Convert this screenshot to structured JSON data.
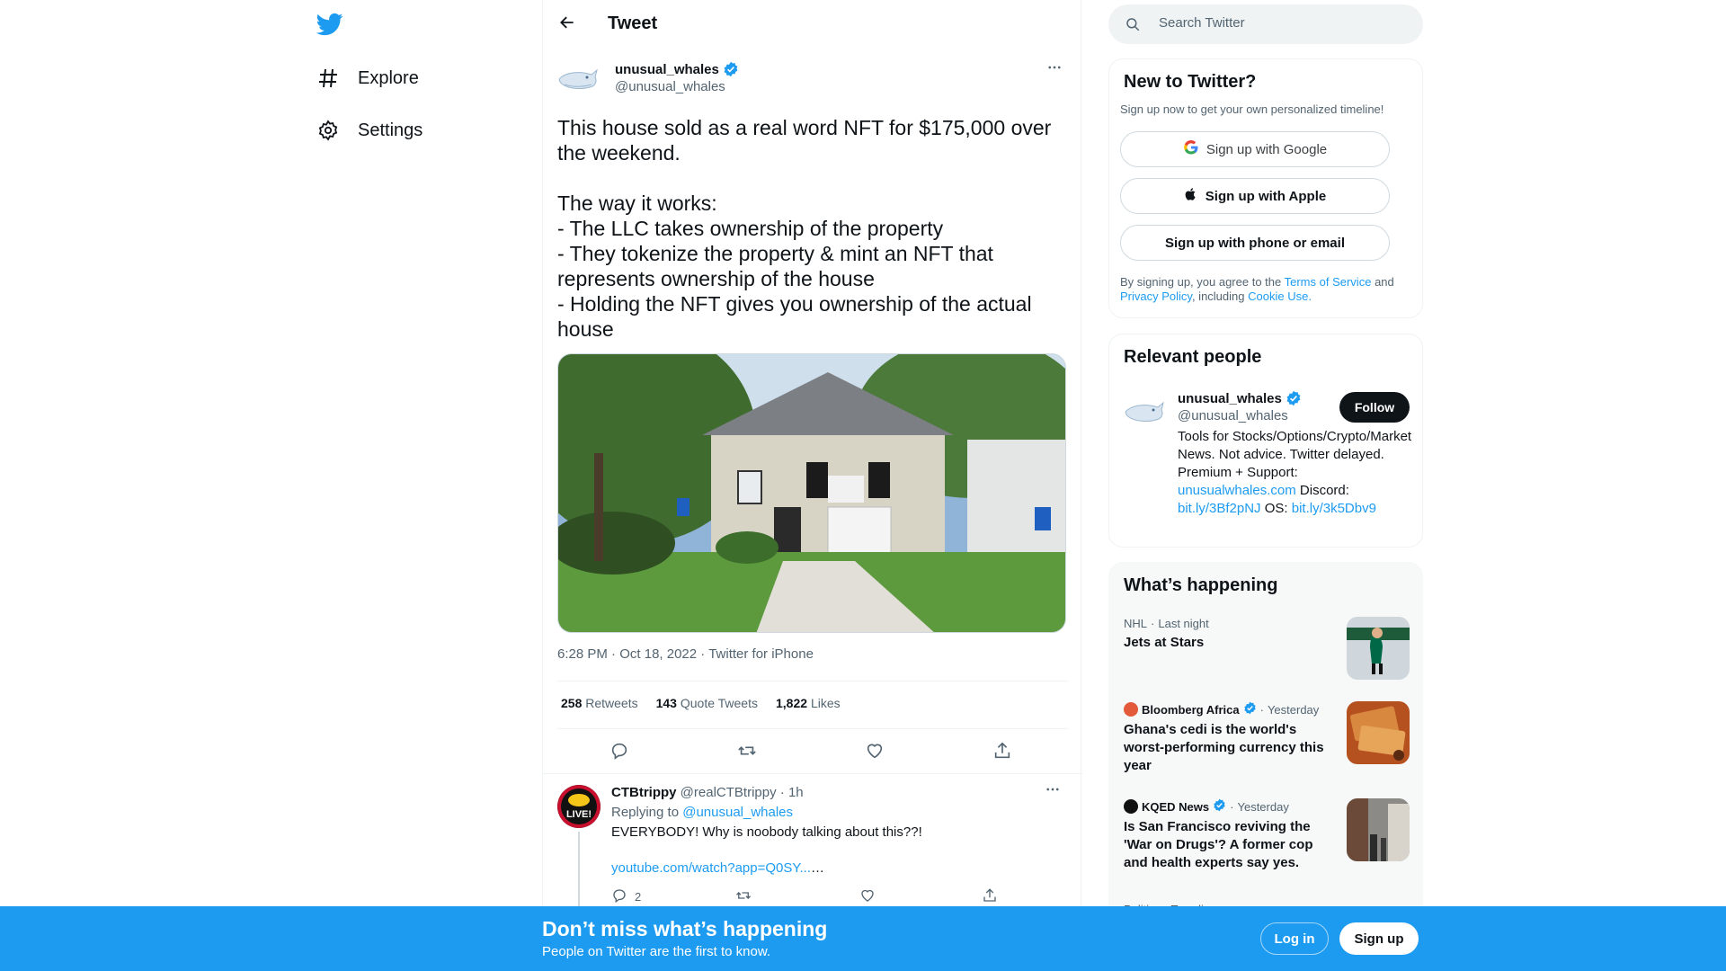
{
  "nav": {
    "items": [
      {
        "label": "Explore",
        "icon": "hashtag-icon"
      },
      {
        "label": "Settings",
        "icon": "gear-icon"
      }
    ]
  },
  "header": {
    "title": "Tweet"
  },
  "tweet": {
    "author_name": "unusual_whales",
    "author_handle": "@unusual_whales",
    "text": "This house sold as a real word NFT for $175,000 over the weekend.\n\nThe way it works:\n- The LLC takes ownership of the property\n- They tokenize the property & mint an NFT that represents ownership of the house\n- Holding the NFT gives you ownership of the actual house",
    "time": "6:28 PM",
    "date": "Oct 18, 2022",
    "source": "Twitter for iPhone",
    "retweets": "258",
    "retweets_label": "Retweets",
    "quotes": "143",
    "quotes_label": "Quote Tweets",
    "likes": "1,822",
    "likes_label": "Likes"
  },
  "reply": {
    "name": "CTBtrippy",
    "handle": "@realCTBtrippy",
    "time": "1h",
    "replying_prefix": "Replying to",
    "replying_to": "@unusual_whales",
    "text": "EVERYBODY! Why is noobody talking about this??!",
    "link": "youtube.com/watch?app=Q0SY...",
    "link_suffix": "…",
    "reply_count": "2",
    "avatar_text": "LIVE!"
  },
  "search": {
    "placeholder": "Search Twitter"
  },
  "new_to_twitter": {
    "title": "New to Twitter?",
    "subtitle": "Sign up now to get your own personalized timeline!",
    "google": "Sign up with Google",
    "apple": "Sign up with Apple",
    "phone": "Sign up with phone or email",
    "legal_1": "By signing up, you agree to the",
    "terms": "Terms of Service",
    "legal_2": "and",
    "privacy": "Privacy Policy",
    "legal_3": ", including",
    "cookie": "Cookie Use."
  },
  "relevant": {
    "title": "Relevant people",
    "name": "unusual_whales",
    "handle": "@unusual_whales",
    "follow": "Follow",
    "bio_1": "Tools for Stocks/Options/Crypto/Market News. Not advice. Twitter delayed. Premium + Support:",
    "bio_link_1": "unusualwhales.com",
    "bio_2": "Discord:",
    "bio_link_2": "bit.ly/3Bf2pNJ",
    "bio_3": "OS:",
    "bio_link_3": "bit.ly/3k5Dbv9"
  },
  "happening": {
    "title": "What’s happening",
    "items": [
      {
        "category": "NHL",
        "sep": "·",
        "when": "Last night",
        "title": "Jets at Stars"
      },
      {
        "source": "Bloomberg Africa",
        "sep": "·",
        "when": "Yesterday",
        "title": "Ghana's cedi is the world's worst-performing currency this year"
      },
      {
        "source": "KQED News",
        "sep": "·",
        "when": "Yesterday",
        "title": "Is San Francisco reviving the 'War on Drugs'? A former cop and health experts say yes."
      },
      {
        "category": "Politics · Trending"
      }
    ]
  },
  "banner": {
    "headline": "Don’t miss what’s happening",
    "sub": "People on Twitter are the first to know.",
    "login": "Log in",
    "signup": "Sign up"
  },
  "colors": {
    "brand": "#1d9bf0",
    "text": "#0f1419",
    "muted": "#536471"
  }
}
